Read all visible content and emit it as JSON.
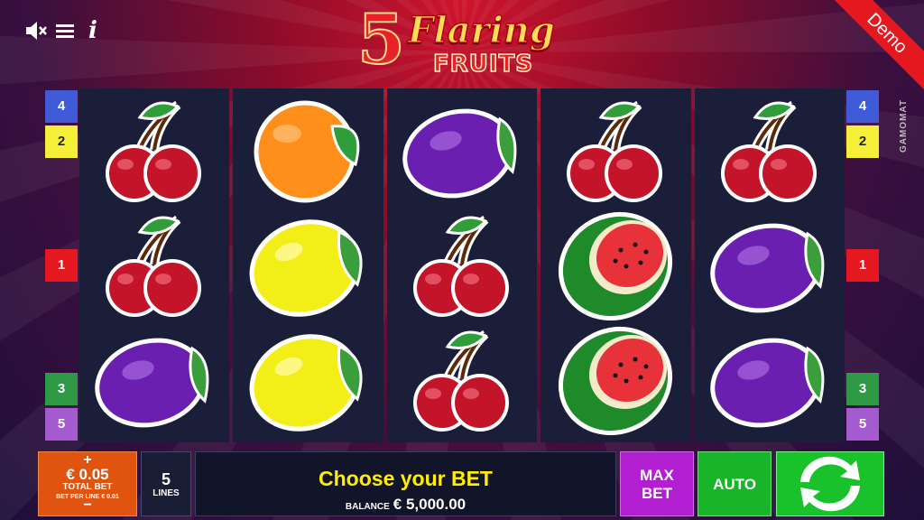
{
  "game": {
    "logo_number": "5",
    "logo_word1": "Flaring",
    "logo_word2": "FRUITS",
    "demo_label": "Demo",
    "provider": "GAMOMAT"
  },
  "controls": {
    "sound_icon": "speaker-muted-icon",
    "menu_icon": "hamburger-menu-icon",
    "info_icon": "info-icon"
  },
  "line_markers": {
    "left": [
      {
        "label": "4",
        "color": "#3f5bd8"
      },
      {
        "label": "2",
        "color": "#f6ef3a"
      },
      {
        "label": "1",
        "color": "#e5171f"
      },
      {
        "label": "3",
        "color": "#2f9a46"
      },
      {
        "label": "5",
        "color": "#a45bd0"
      }
    ],
    "right": [
      {
        "label": "4",
        "color": "#3f5bd8"
      },
      {
        "label": "2",
        "color": "#f6ef3a"
      },
      {
        "label": "1",
        "color": "#e5171f"
      },
      {
        "label": "3",
        "color": "#2f9a46"
      },
      {
        "label": "5",
        "color": "#a45bd0"
      }
    ]
  },
  "reels": [
    [
      "cherry",
      "cherry",
      "plum"
    ],
    [
      "orange",
      "lemon",
      "lemon"
    ],
    [
      "plum",
      "cherry",
      "cherry"
    ],
    [
      "cherry",
      "watermelon",
      "watermelon"
    ],
    [
      "cherry",
      "plum",
      "plum"
    ]
  ],
  "bottom_bar": {
    "bet_plus": "+",
    "bet_value": "€ 0.05",
    "bet_label": "TOTAL BET",
    "bet_per_line": "BET PER LINE € 0.01",
    "bet_minus": "−",
    "lines_count": "5",
    "lines_label": "LINES",
    "message": "Choose your BET",
    "balance_label": "BALANCE",
    "balance_value": "€ 5,000.00",
    "max_bet_label": "MAX BET",
    "auto_label": "AUTO",
    "spin_icon": "spin-arrows-icon"
  },
  "colors": {
    "bet_button": "#e0540f",
    "max_bet_button": "#b11fd0",
    "auto_button": "#18b52a",
    "spin_button": "#19c22b",
    "message_text": "#ffee00"
  }
}
